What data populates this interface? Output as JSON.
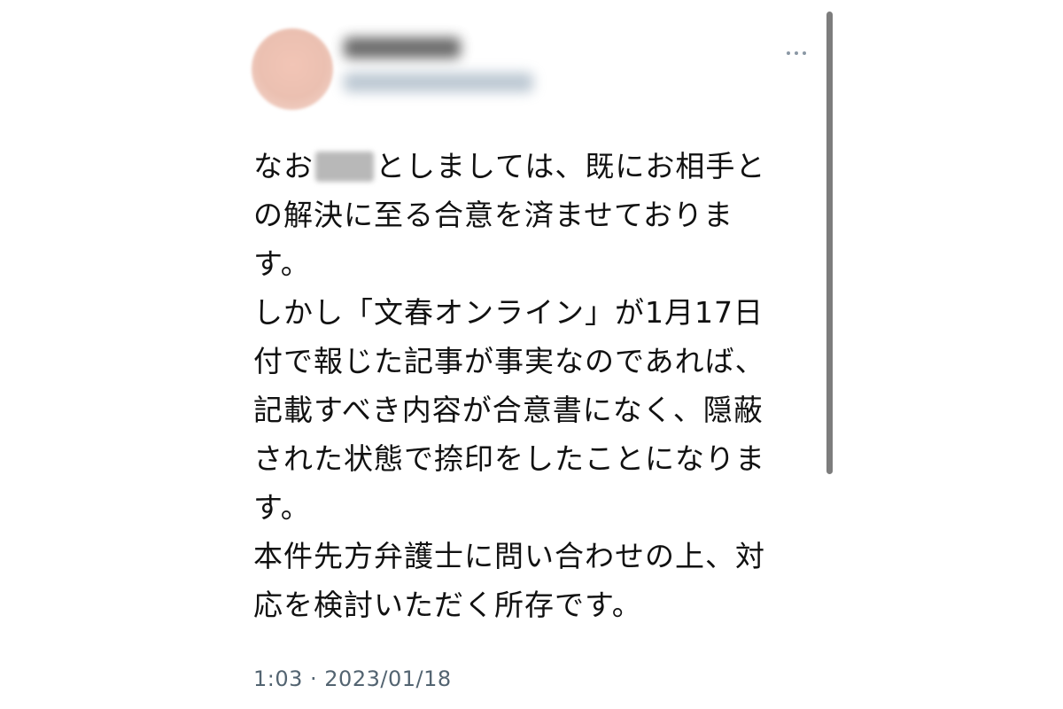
{
  "post": {
    "lines": [
      {
        "pre": "なお",
        "post": "としましては、既にお相手と"
      },
      "の解決に至る合意を済ませておりま",
      "す。",
      "しかし「文春オンライン」が1月17日",
      "付で報じた記事が事実なのであれば、",
      "記載すべき内容が合意書になく、隠蔽",
      "された状態で捺印をしたことになりま",
      "す。",
      "本件先方弁護士に問い合わせの上、対",
      "応を検討いただく所存です。"
    ],
    "timestamp": "1:03 · 2023/01/18"
  },
  "icons": {
    "more": "more-horizontal-icon"
  }
}
